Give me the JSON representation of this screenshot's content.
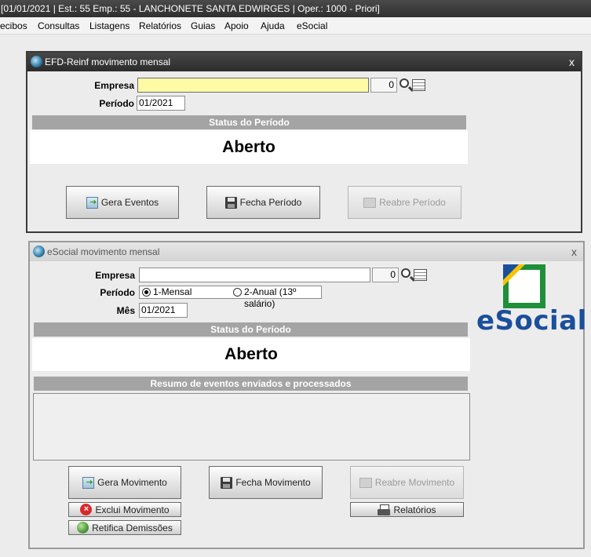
{
  "app": {
    "title": "[01/01/2021 | Est.: 55 Emp.: 55 - LANCHONETE SANTA EDWIRGES  | Oper.: 1000 - Priori]"
  },
  "menu": [
    "ecibos",
    "Consultas",
    "Listagens",
    "Relatórios",
    "Guias",
    "Apoio",
    "Ajuda",
    "eSocial"
  ],
  "reinf": {
    "title": "EFD-Reinf movimento mensal",
    "close": "x",
    "empresa_label": "Empresa",
    "empresa_value": "",
    "empresa_code": "0",
    "periodo_label": "Período",
    "periodo_value": "01/2021",
    "status_header": "Status do Período",
    "status_value": "Aberto",
    "btn_gera": "Gera Eventos",
    "btn_fecha": "Fecha Período",
    "btn_reabre": "Reabre Período"
  },
  "esocial": {
    "title": "eSocial movimento mensal",
    "close": "x",
    "empresa_label": "Empresa",
    "empresa_value": "",
    "empresa_code": "0",
    "periodo_label": "Período",
    "periodo_option1": "1-Mensal",
    "periodo_option2": "2-Anual (13º salário)",
    "periodo_selected": "1-Mensal",
    "mes_label": "Mês",
    "mes_value": "01/2021",
    "status_header": "Status do Período",
    "status_value": "Aberto",
    "resumo_header": "Resumo de eventos enviados e processados",
    "btn_gera": "Gera Movimento",
    "btn_fecha": "Fecha Movimento",
    "btn_reabre": "Reabre Movimento",
    "btn_exclui": "Exclui Movimento",
    "btn_relatorios": "Relatórios",
    "btn_retifica": "Retifica Demissões",
    "logo_text": "eSocial"
  },
  "colors": {
    "logo_green": "#1f8f3a",
    "logo_blue": "#1b4f9c",
    "logo_yellow": "#f4c500",
    "input_highlight": "#fffaa6"
  },
  "icons": {
    "window": "app-globe-icon",
    "lookup": "search-icon",
    "gera": "generate-icon",
    "fecha": "save-disk-icon",
    "reabre": "open-folder-icon",
    "exclui": "delete-icon",
    "relatorios": "printer-icon",
    "retifica": "globe-icon"
  }
}
